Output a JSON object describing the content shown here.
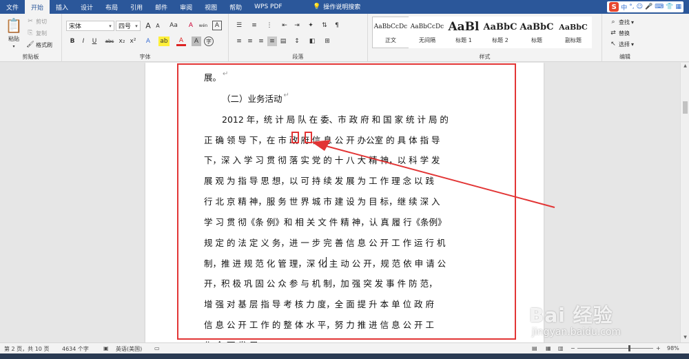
{
  "tabs": [
    "文件",
    "开始",
    "插入",
    "设计",
    "布局",
    "引用",
    "邮件",
    "审阅",
    "视图",
    "帮助",
    "WPS PDF"
  ],
  "active_tab": "开始",
  "tell_me": "操作说明搜索",
  "ime": {
    "logo": "S",
    "items": [
      "中",
      "°,",
      "☺",
      "🎤",
      "⌨",
      "👕",
      "▦"
    ]
  },
  "clipboard": {
    "paste": "粘贴",
    "cut": "剪切",
    "copy": "复制",
    "format_painter": "格式刷",
    "label": "剪贴板"
  },
  "font": {
    "name": "宋体",
    "size": "四号",
    "label": "字体",
    "grow": "A",
    "shrink": "A",
    "case": "Aa",
    "clear": "A",
    "phonetic": "wén",
    "border": "A",
    "bold": "B",
    "italic": "I",
    "underline": "U",
    "strike": "abc",
    "sub": "x₂",
    "sup": "x²",
    "effects": "A",
    "highlight": "ab",
    "color": "A",
    "shade": "A",
    "enclose": "字"
  },
  "paragraph": {
    "label": "段落"
  },
  "styles": {
    "label": "样式",
    "items": [
      {
        "preview": "AaBbCcDc",
        "name": "正文"
      },
      {
        "preview": "AaBbCcDc",
        "name": "无间隔"
      },
      {
        "preview": "AaBl",
        "name": "标题 1"
      },
      {
        "preview": "AaBbC",
        "name": "标题 2"
      },
      {
        "preview": "AaBbC",
        "name": "标题"
      },
      {
        "preview": "AaBbC",
        "name": "副标题"
      }
    ]
  },
  "editing": {
    "find": "查找",
    "replace": "替换",
    "select": "选择",
    "label": "编辑"
  },
  "document": {
    "lines": [
      "展。",
      "（二）业务活动",
      "2012 年，统 计 局 队 在 委、市 政 府 和 国 家 统 计 局 的",
      "正 确 领 导 下，在 市 政 府 信 息 公 开 办公室 的 具 体 指 导",
      "下，深 入 学 习 贯 彻  落 实 党 的 十 八 大 精 神，以 科 学 发",
      "展 观 为 指 导 思 想，以 可 持 续 发 展 为 工 作 理 念 以 践",
      "行 北 京 精 神，服 务 世 界 城 市 建 设 为 目 标，继 续 深 入",
      "学 习 贯 彻《条 例》和 相 关 文 件 精 神，认 真 履 行《条例》",
      "规 定 的 法 定 义 务，进 一 步 完 善 信 息 公 开 工 作 运 行 机",
      "制，推 进 规 范 化 管 理，深 化 主 动 公 开，规 范 依 申 请 公",
      "开，积 极 巩 固 公 众 参 与 机 制，加 强 突 发 事 件 防 范，",
      "增 强 对 基 层 指 导 考 核 力 度，全 面 提 升 本 单 位 政 府",
      "信 息 公 开 工 作 的 整 体 水 平，努 力 推 进 信 息 公 开 工",
      "作 全 面 发 展。"
    ],
    "para_mark": "↵"
  },
  "status": {
    "page": "第 2 页，共 10 页",
    "words": "4634 个字",
    "language": "英语(美国)",
    "zoom": "98%"
  },
  "zoom_fraction": 0.98,
  "watermark": {
    "logo": "Bai 经验",
    "url": "jingyan.baidu.com"
  },
  "colors": {
    "tab_bar": "#2b579a",
    "highlight_box": "#e23535"
  }
}
